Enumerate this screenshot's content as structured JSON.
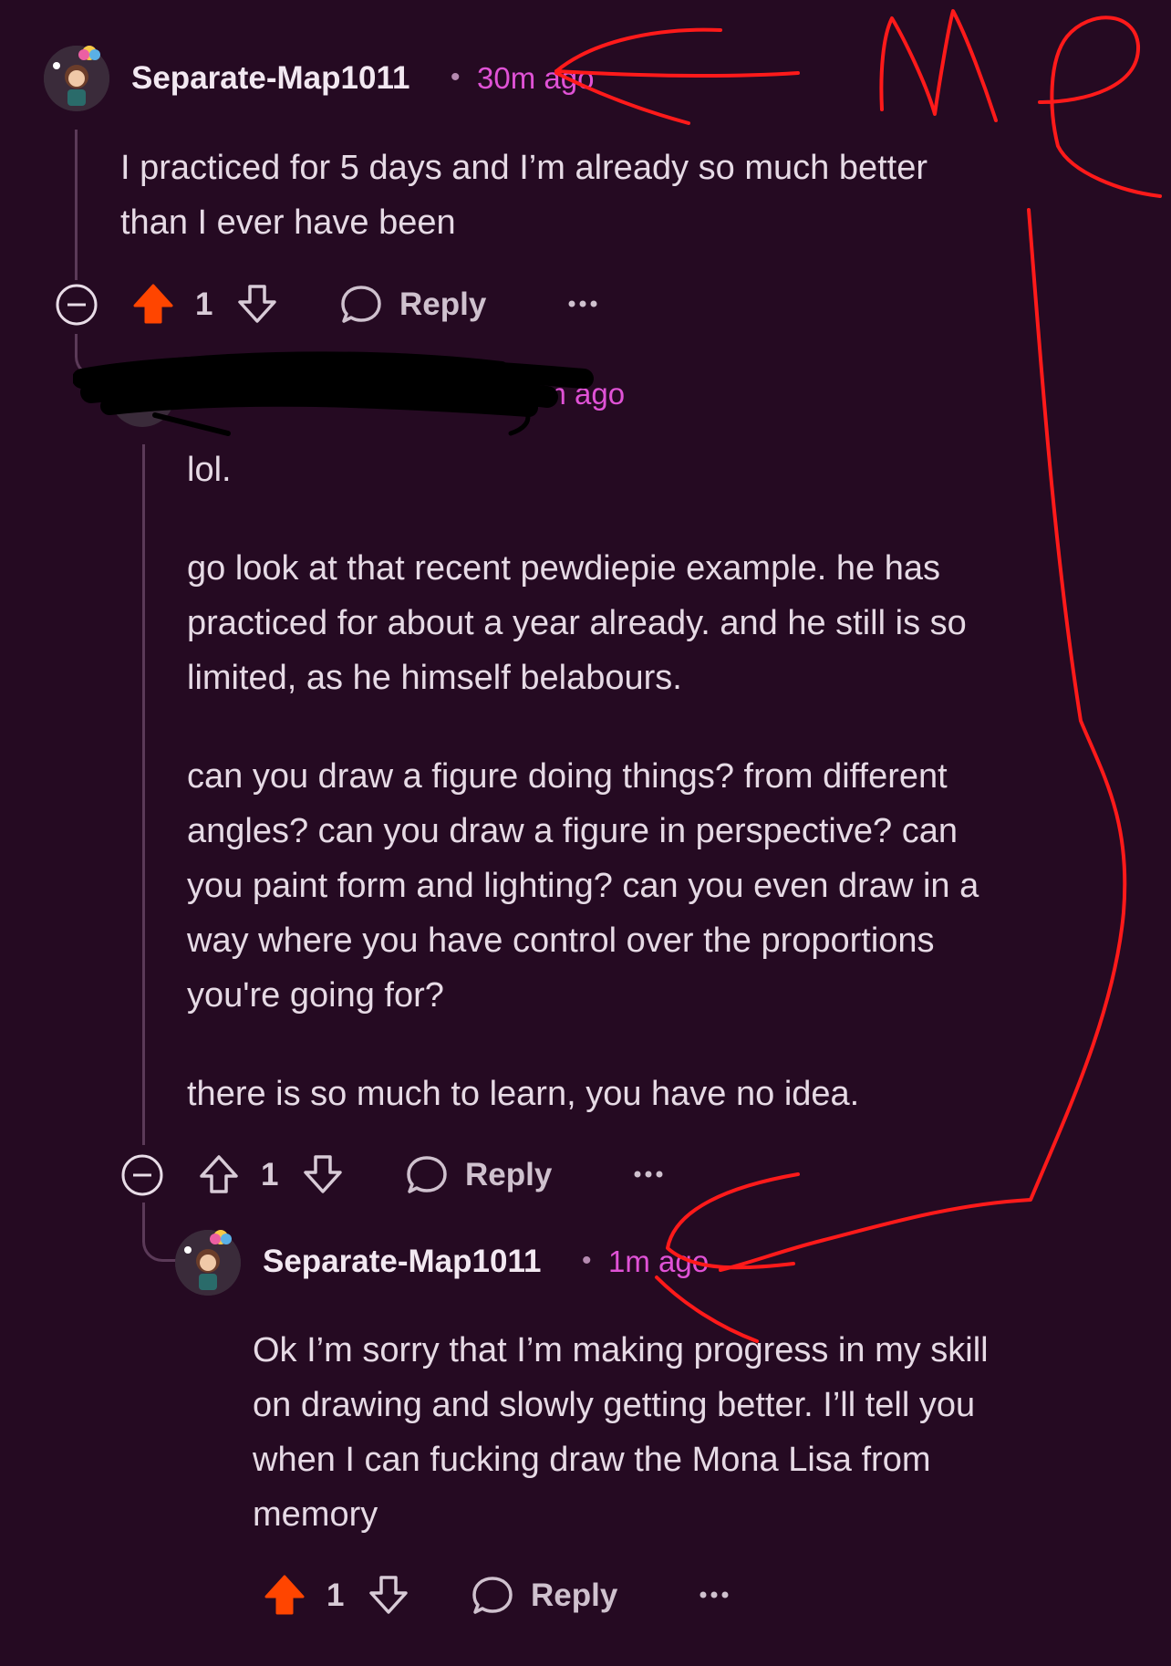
{
  "comments": [
    {
      "username": "Separate-Map1011",
      "timestamp": "30m ago",
      "body": [
        "I practiced for 5 days and I’m already so much better",
        "than I ever have been"
      ],
      "votes": "1",
      "upvoted": true,
      "reply_label": "Reply"
    },
    {
      "username": "",
      "username_redacted": true,
      "timestamp": "1m ago",
      "body_paragraphs": [
        [
          "lol."
        ],
        [
          "go look at that recent pewdiepie example. he has",
          "practiced for about a year already. and he still is so",
          "limited, as he himself belabours."
        ],
        [
          "can you draw a figure doing things? from different",
          "angles? can you draw a figure in perspective? can",
          "you paint form and lighting? can you even draw in a",
          "way where you have control over the proportions",
          "you're going for?"
        ],
        [
          "there is so much to learn, you have no idea."
        ]
      ],
      "votes": "1",
      "upvoted": false,
      "reply_label": "Reply"
    },
    {
      "username": "Separate-Map1011",
      "timestamp": "1m ago",
      "body": [
        "Ok I’m sorry that I’m making progress in my skill",
        "on drawing and slowly getting better. I’ll tell you",
        "when I can fucking draw the Mona Lisa from",
        "memory"
      ],
      "votes": "1",
      "upvoted": true,
      "reply_label": "Reply"
    }
  ],
  "colors": {
    "background": "#250a22",
    "upvote_active": "#ff4500",
    "timestamp": "#e052d6",
    "annotation_red": "#ff1a1a"
  },
  "icons": [
    "collapse-icon",
    "upvote-icon",
    "downvote-icon",
    "reply-bubble-icon",
    "more-icon",
    "avatar"
  ]
}
